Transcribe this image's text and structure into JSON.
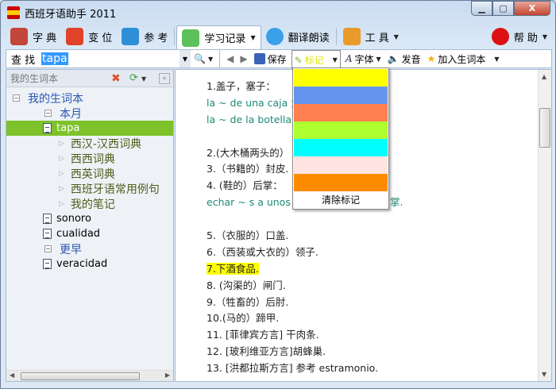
{
  "window": {
    "title": "西班牙语助手 2011",
    "min": "▁",
    "max": "▢",
    "close": "X"
  },
  "toolbar": {
    "items": [
      {
        "label": "字 典",
        "icon": "books-icon",
        "color": "#c4453a"
      },
      {
        "label": "变 位",
        "icon": "cubes-icon",
        "color": "#e0422a"
      },
      {
        "label": "参 考",
        "icon": "folder-icon",
        "color": "#2f8fd6"
      },
      {
        "label": "学习记录",
        "icon": "study-record-icon",
        "color": "#5cc15c"
      },
      {
        "label": "翻译朗读",
        "icon": "speech-bubble-icon",
        "color": "#3aa0e8"
      },
      {
        "label": "工 具",
        "icon": "wrench-icon",
        "color": "#e99a2a"
      },
      {
        "label": "帮 助",
        "icon": "help-icon",
        "color": "#dd1111"
      }
    ]
  },
  "search": {
    "label": "查 找",
    "value": "tapa"
  },
  "tools": {
    "save": "保存",
    "mark": "标记",
    "font": "字体",
    "pronounce": "发音",
    "add_vocab": "加入生词本"
  },
  "left": {
    "header": "我的生词本",
    "tree": [
      {
        "label": "我的生词本",
        "level": 0,
        "type": "group"
      },
      {
        "label": "本月",
        "level": 1,
        "type": "group"
      },
      {
        "label": "tapa",
        "level": 2,
        "type": "word",
        "selected": true
      },
      {
        "label": "西汉-汉西词典",
        "level": 3,
        "type": "dict"
      },
      {
        "label": "西西词典",
        "level": 3,
        "type": "dict"
      },
      {
        "label": "西英词典",
        "level": 3,
        "type": "dict"
      },
      {
        "label": "西班牙语常用例句",
        "level": 3,
        "type": "dict"
      },
      {
        "label": "我的笔记",
        "level": 3,
        "type": "dict"
      },
      {
        "label": "sonoro",
        "level": 2,
        "type": "word"
      },
      {
        "label": "cualidad",
        "level": 2,
        "type": "word"
      },
      {
        "label": "更早",
        "level": 1,
        "type": "group"
      },
      {
        "label": "veracidad",
        "level": 2,
        "type": "word"
      }
    ]
  },
  "content": {
    "lines": [
      {
        "text": "1.盖子，塞子：",
        "style": ""
      },
      {
        "text": "la ~ de una caja 盒",
        "style": "ex"
      },
      {
        "text": "la ~ de la botella 瓶",
        "style": "ex"
      },
      {
        "text": "",
        "style": ""
      },
      {
        "text": "2.(大木桶两头的）",
        "style": ""
      },
      {
        "text": "3.（书籍的）封皮.",
        "style": ""
      },
      {
        "text": "4. (鞋的）后掌：",
        "style": ""
      },
      {
        "text": "echar ~ s a unos z",
        "style": "ex",
        "tail": "掌."
      },
      {
        "text": "",
        "style": ""
      },
      {
        "text": "5.（衣服的）口盖.",
        "style": ""
      },
      {
        "text": "6.（西装或大衣的）领子.",
        "style": ""
      },
      {
        "text": "7.下酒食品.",
        "style": "hl"
      },
      {
        "text": "8. (沟渠的）闸门.",
        "style": ""
      },
      {
        "text": "9.（牲畜的）后肘.",
        "style": ""
      },
      {
        "text": "10.(马的）蹄甲.",
        "style": ""
      },
      {
        "text": "11. [菲律宾方言] 干肉条.",
        "style": ""
      },
      {
        "text": "12. [玻利维亚方言]胡蜂巢.",
        "style": ""
      },
      {
        "text": "13. [洪都拉斯方言] 参考  estramonio.",
        "style": ""
      }
    ]
  },
  "mark_menu": {
    "colors": [
      "#FFFF00",
      "#6495ED",
      "#FF7F50",
      "#ADFF2F",
      "#00FFFF",
      "#FFE4E1",
      "#FF8C00"
    ],
    "clear": "清除标记"
  }
}
